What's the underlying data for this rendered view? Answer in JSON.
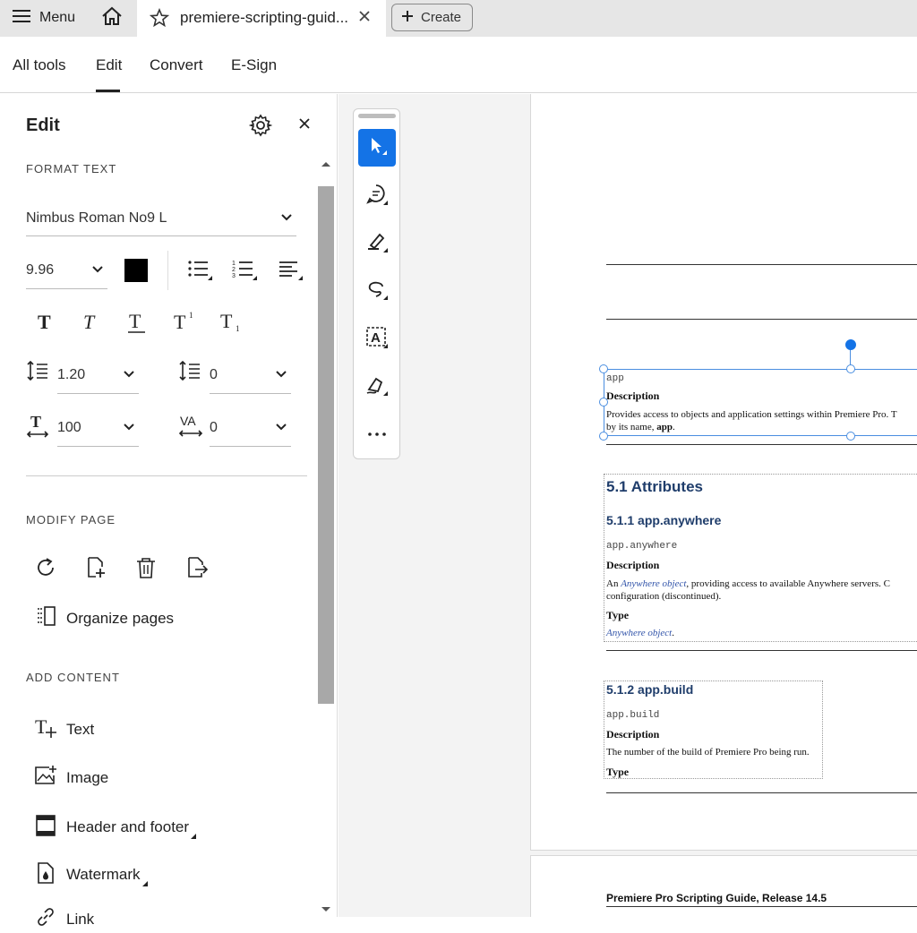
{
  "topbar": {
    "menu_label": "Menu",
    "tab_title": "premiere-scripting-guid...",
    "create_label": "Create"
  },
  "menubar": {
    "items": [
      "All tools",
      "Edit",
      "Convert",
      "E-Sign"
    ],
    "active": "Edit"
  },
  "edit_panel": {
    "title": "Edit",
    "format_text": {
      "section_label": "FORMAT TEXT",
      "font_family": "Nimbus Roman No9 L",
      "font_size": "9.96",
      "text_color": "#000000",
      "line_spacing": "1.20",
      "paragraph_spacing": "0",
      "horizontal_scale": "100",
      "char_spacing": "0"
    },
    "modify_page": {
      "section_label": "MODIFY PAGE",
      "organize_label": "Organize pages"
    },
    "add_content": {
      "section_label": "ADD CONTENT",
      "items": [
        "Text",
        "Image",
        "Header and footer",
        "Watermark",
        "Link"
      ]
    }
  },
  "toolbar": {
    "tools": [
      "select-tool",
      "comment-tool",
      "highlight-tool",
      "draw-tool",
      "text-select-tool",
      "sign-tool",
      "more-tools"
    ]
  },
  "document": {
    "selected_block": {
      "code": "app",
      "heading": "Description",
      "text_line1": "Provides access to objects and application settings within Premiere Pro. T",
      "text_line2_prefix": "by its name, ",
      "text_line2_bold": "app",
      "text_line2_suffix": "."
    },
    "section_heading": "5.1  Attributes",
    "sub1": {
      "heading": "5.1.1  app.anywhere",
      "code": "app.anywhere",
      "desc_label": "Description",
      "desc_prefix": "An ",
      "desc_link": "Anywhere object",
      "desc_rest": ", providing access to available Anywhere servers.  C",
      "desc_line2": "configuration (discontinued).",
      "type_label": "Type",
      "type_value": "Anywhere object",
      "type_suffix": "."
    },
    "sub2": {
      "heading": "5.1.2  app.build",
      "code": "app.build",
      "desc_label": "Description",
      "desc_text": "The number of the build of Premiere Pro being run.",
      "type_label": "Type"
    },
    "page2_header": "Premiere Pro Scripting Guide, Release 14.5"
  },
  "colors": {
    "accent": "#1473e6",
    "heading_blue": "#1f3d6b",
    "link_blue": "#3355aa",
    "selection": "#4a8ee0"
  }
}
